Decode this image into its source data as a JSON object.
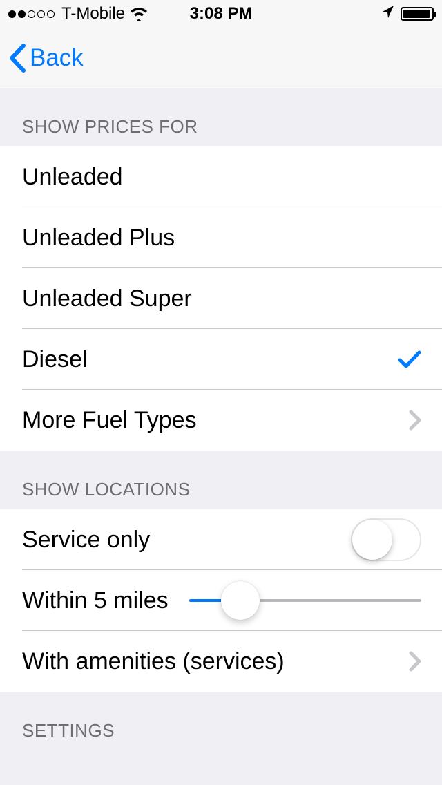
{
  "status": {
    "carrier": "T-Mobile",
    "time": "3:08 PM"
  },
  "nav": {
    "back_label": "Back"
  },
  "sections": {
    "prices": {
      "header": "SHOW PRICES FOR",
      "items": [
        {
          "label": "Unleaded",
          "selected": false
        },
        {
          "label": "Unleaded Plus",
          "selected": false
        },
        {
          "label": "Unleaded Super",
          "selected": false
        },
        {
          "label": "Diesel",
          "selected": true
        }
      ],
      "more_label": "More Fuel Types"
    },
    "locations": {
      "header": "SHOW LOCATIONS",
      "service_only_label": "Service only",
      "service_only_on": false,
      "distance_label": "Within 5 miles",
      "distance_percent": 22,
      "amenities_label": "With amenities (services)"
    },
    "settings": {
      "header": "SETTINGS"
    }
  },
  "colors": {
    "accent": "#007aff"
  }
}
